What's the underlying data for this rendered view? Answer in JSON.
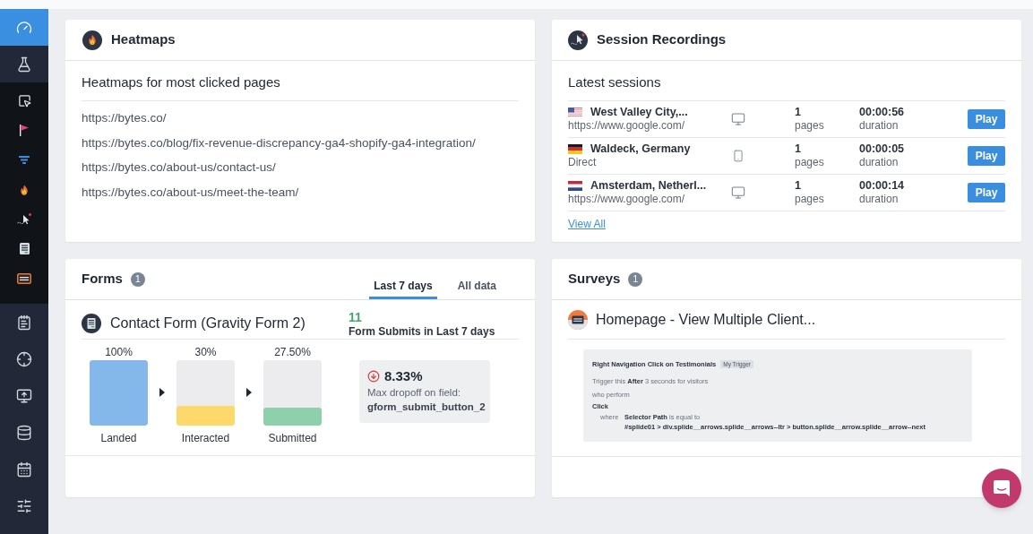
{
  "sidebar": {
    "items": [
      {
        "selected": true
      },
      {
        "selected": false,
        "expanded": true,
        "children": [
          {
            "selected": false
          },
          {
            "selected": false
          },
          {
            "selected": false
          },
          {
            "selected": false
          },
          {
            "selected": false
          },
          {
            "selected": false
          },
          {
            "selected": false
          }
        ]
      },
      {
        "selected": false
      },
      {
        "selected": false
      },
      {
        "selected": false
      },
      {
        "selected": false
      },
      {
        "selected": false
      },
      {
        "selected": false
      }
    ]
  },
  "heatmaps": {
    "title": "Heatmaps",
    "subtitle": "Heatmaps for most clicked pages",
    "pages": [
      "https://bytes.co/",
      "https://bytes.co/blog/fix-revenue-discrepancy-ga4-shopify-ga4-integration/",
      "https://bytes.co/about-us/contact-us/",
      "https://bytes.co/about-us/meet-the-team/"
    ]
  },
  "session_recordings": {
    "title": "Session Recordings",
    "subtitle": "Latest sessions",
    "sessions": [
      {
        "flag": {
          "kind": "us"
        },
        "location": "West Valley City,...",
        "source": "https://www.google.com/",
        "device": {
          "kind": "desktop"
        },
        "pages": "1",
        "pages_label": "pages",
        "duration": "00:00:56",
        "duration_label": "duration",
        "action": "Play"
      },
      {
        "flag": {
          "kind": "de"
        },
        "location": "Waldeck, Germany",
        "source": "Direct",
        "device": {
          "kind": "mobile"
        },
        "pages": "1",
        "pages_label": "pages",
        "duration": "00:00:05",
        "duration_label": "duration",
        "action": "Play"
      },
      {
        "flag": {
          "kind": "nl"
        },
        "location": "Amsterdam, Netherl...",
        "source": "https://www.google.com/",
        "device": {
          "kind": "desktop"
        },
        "pages": "1",
        "pages_label": "pages",
        "duration": "00:00:14",
        "duration_label": "duration",
        "action": "Play"
      }
    ],
    "view_all": "View All"
  },
  "forms": {
    "title": "Forms",
    "count": "1",
    "tabs": [
      {
        "label": "Last 7 days",
        "selected": true
      },
      {
        "label": "All data",
        "selected": false
      }
    ],
    "form": {
      "name": "Contact Form (Gravity Form 2)",
      "submits": "11",
      "submits_label": "Form Submits in Last 7 days",
      "funnel": [
        {
          "percent": "100%",
          "label": "Landed",
          "level": 1,
          "color": "#85b8ea"
        },
        {
          "percent": "30%",
          "label": "Interacted",
          "level": 0.3,
          "color": "#fdd86b"
        },
        {
          "percent": "27.50%",
          "label": "Submitted",
          "level": 0.275,
          "color": "#8fd0ac"
        }
      ],
      "dropoff": {
        "value": "8.33%",
        "label": "Max dropoff on field:",
        "field": "gform_submit_button_2"
      }
    }
  },
  "surveys": {
    "title": "Surveys",
    "count": "1",
    "survey": {
      "name": "Homepage - View Multiple Client...",
      "trigger": {
        "name": "Right Navigation Click on Testimonials",
        "tag": "My Trigger",
        "timing": "Trigger this **After** 3 seconds for visitors",
        "audience": "who perform",
        "event": "Click",
        "where_label": "where",
        "condition": "**Selector Path** is equal to",
        "value": "#splide01 > div.splide__arrows.splide__arrows--ltr > button.splide__arrow.splide__arrow--next"
      }
    }
  }
}
